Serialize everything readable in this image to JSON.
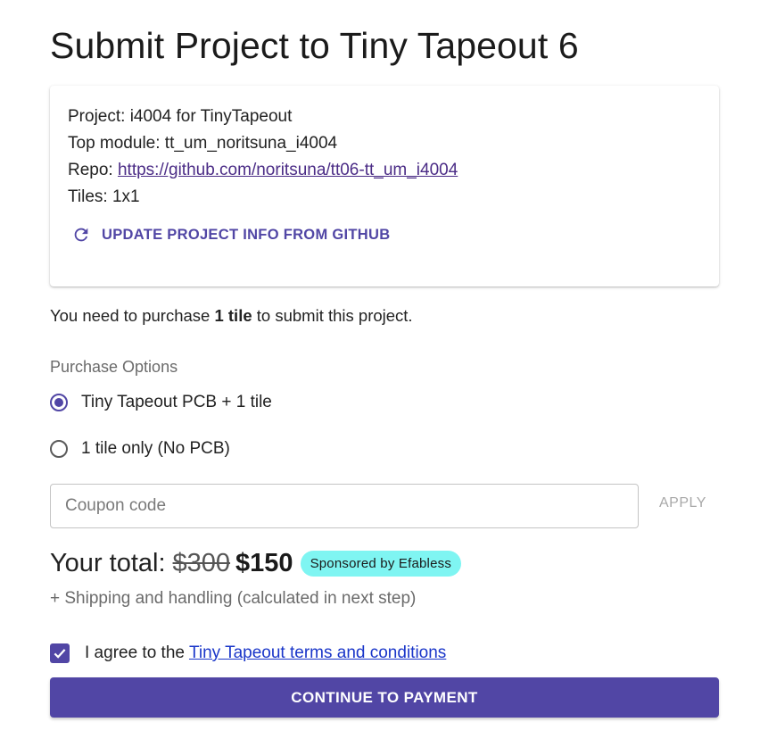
{
  "page": {
    "title": "Submit Project to Tiny Tapeout 6"
  },
  "project": {
    "project_prefix": "Project:",
    "project_name": "i4004 for TinyTapeout",
    "top_module_prefix": "Top module:",
    "top_module": "tt_um_noritsuna_i4004",
    "repo_prefix": "Repo:",
    "repo_url": "https://github.com/noritsuna/tt06-tt_um_i4004",
    "tiles_prefix": "Tiles:",
    "tiles": "1x1",
    "update_label": "UPDATE PROJECT INFO FROM GITHUB",
    "update_icon": "refresh-icon"
  },
  "purchase": {
    "text_before": "You need to purchase",
    "tiles_needed": "1 tile",
    "text_after": "to submit this project.",
    "options_label": "Purchase Options",
    "options": [
      {
        "label": "Tiny Tapeout PCB + 1 tile",
        "selected": true
      },
      {
        "label": "1 tile only (No PCB)",
        "selected": false
      }
    ]
  },
  "coupon": {
    "placeholder": "Coupon code",
    "value": "",
    "apply_label": "APPLY"
  },
  "total": {
    "label": "Your total:",
    "old_price": "$300",
    "new_price": "$150",
    "badge": "Sponsored by Efabless",
    "shipping_note": "+ Shipping and handling (calculated in next step)"
  },
  "agreement": {
    "checked": true,
    "text": "I agree to the",
    "link_text": "Tiny Tapeout terms and conditions"
  },
  "continue_label": "CONTINUE TO PAYMENT",
  "colors": {
    "primary": "#5146a5",
    "badge_bg": "#7ff5f2",
    "link": "#1a36c9",
    "repo_link": "#4b2c86"
  }
}
